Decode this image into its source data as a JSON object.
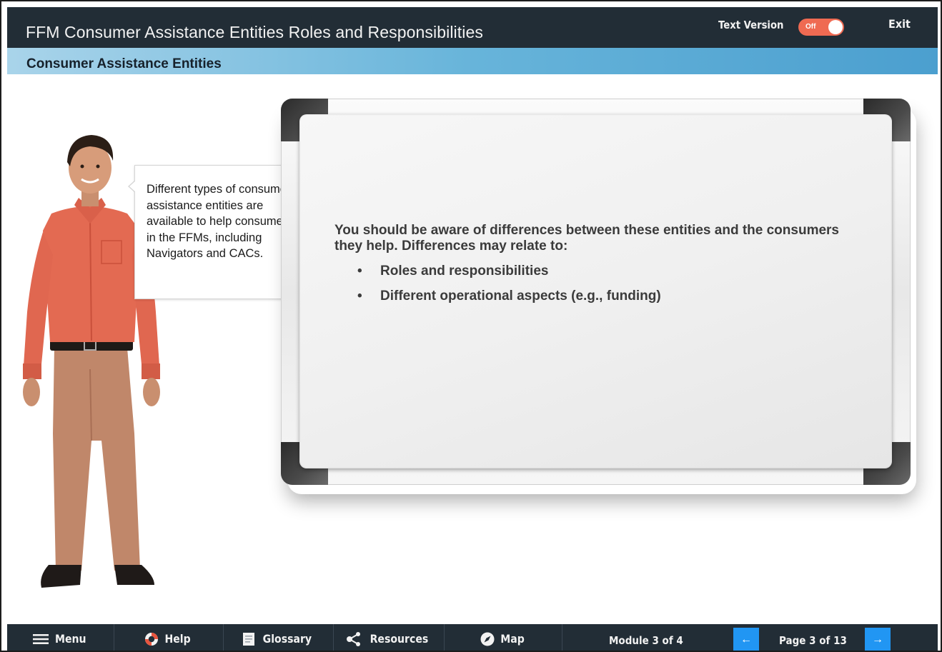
{
  "header": {
    "course_title": "FFM Consumer Assistance Entities Roles and Responsibilities",
    "text_version_label": "Text Version",
    "toggle_state": "Off",
    "exit_label": "Exit"
  },
  "subheader": {
    "section_title": "Consumer Assistance Entities"
  },
  "bubble": {
    "text": "Different types of consumer assistance entities are available to help consumers in the FFMs, including Navigators and CACs."
  },
  "board": {
    "intro": "You should be aware of differences between these entities and the consumers they help. Differences may relate to:",
    "bullets": [
      "Roles and responsibilities",
      "Different operational aspects (e.g., funding)"
    ]
  },
  "footer": {
    "menu_label": "Menu",
    "help_label": "Help",
    "glossary_label": "Glossary",
    "resources_label": "Resources",
    "map_label": "Map",
    "module_text": "Module 3 of 4",
    "prev_icon": "←",
    "page_text": "Page 3 of 13",
    "next_icon": "→"
  },
  "colors": {
    "header_bg": "#222d36",
    "accent_blue": "#2196f3",
    "toggle_off": "#ef6a52",
    "subheader_blue": "#4b9fcf"
  }
}
